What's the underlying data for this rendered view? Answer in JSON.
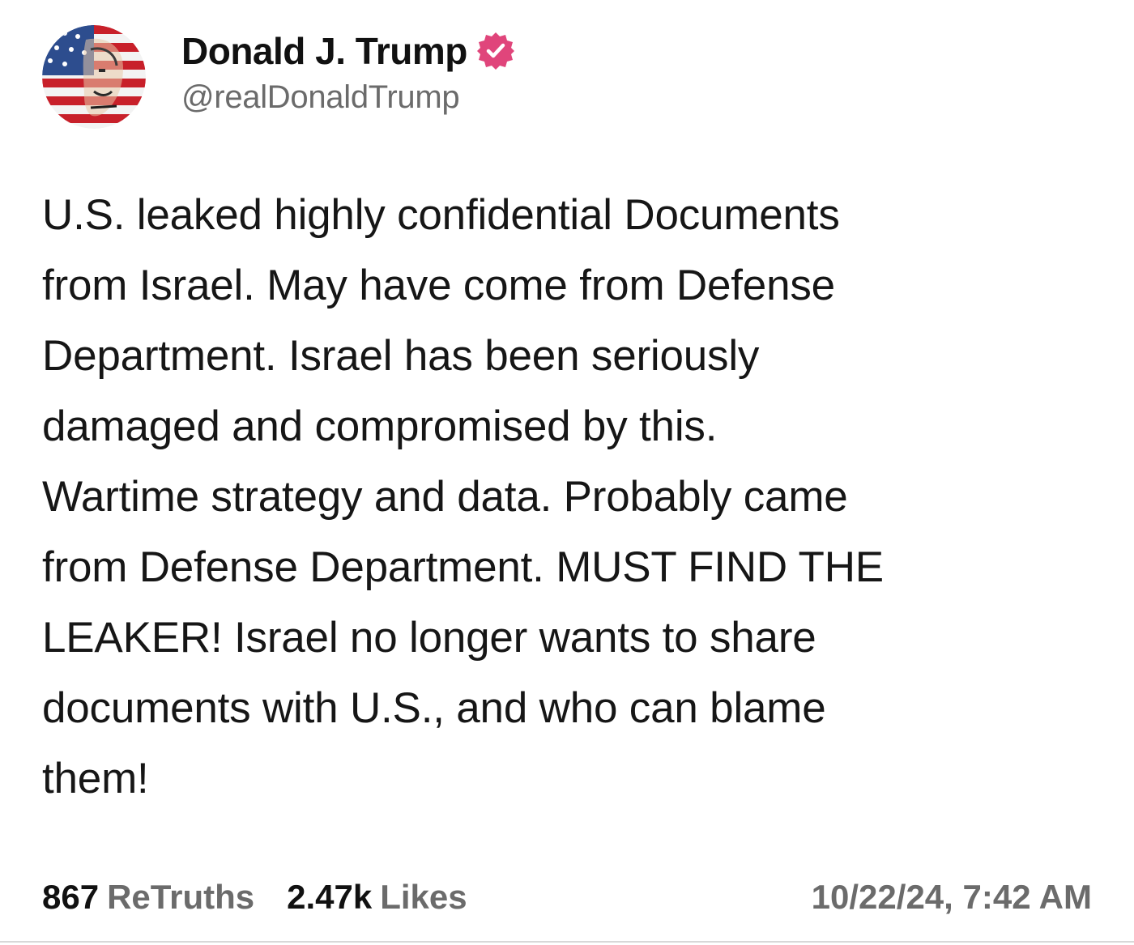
{
  "author": {
    "display_name": "Donald J. Trump",
    "handle": "@realDonaldTrump",
    "verified": true,
    "verified_color": "#e0457b",
    "avatar_icon": "flag-portrait-avatar"
  },
  "post": {
    "text": "U.S. leaked highly confidential Documents from Israel. May have come from Defense Department. Israel has been seriously damaged and compromised by this. Wartime strategy and data. Probably came from Defense Department. MUST FIND THE LEAKER! Israel no longer wants to share documents with U.S., and who can blame them!",
    "lines": [
      "U.S. leaked highly confidential Documents",
      "from Israel. May have come from Defense",
      "Department. Israel has been seriously",
      "damaged and compromised by this.",
      "Wartime strategy and data. Probably came",
      "from Defense Department. MUST FIND THE",
      "LEAKER! Israel no longer wants to share",
      "documents with U.S., and who can blame",
      "them!"
    ]
  },
  "stats": {
    "retruths_count": "867",
    "retruths_label": "ReTruths",
    "likes_count": "2.47k",
    "likes_label": "Likes"
  },
  "timestamp": "10/22/24, 7:42 AM"
}
